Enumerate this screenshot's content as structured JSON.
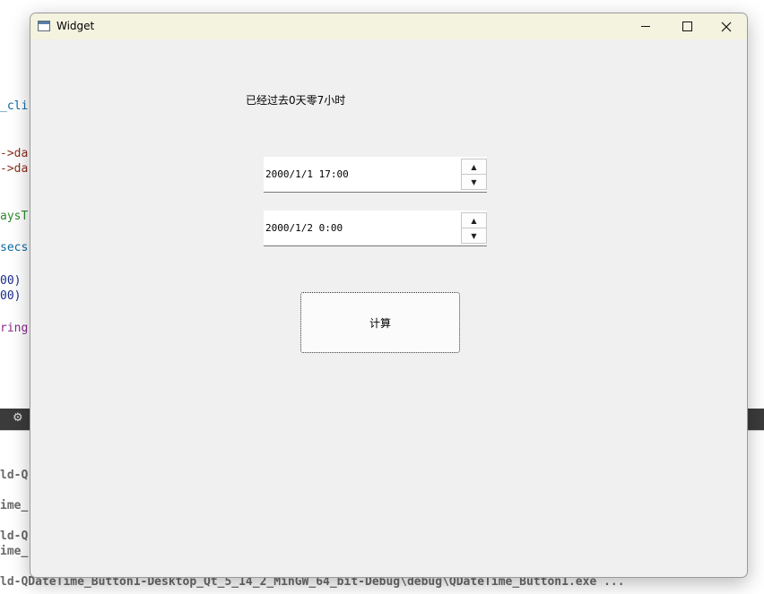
{
  "background": {
    "code_fragments": [
      "_cli",
      "->da",
      "->da",
      "aysT",
      "secs",
      "00)",
      "00)",
      "ring"
    ],
    "output_lines": [
      "ld-Q",
      "ime_",
      "ld-Q",
      "ime_",
      "ld-QDateTime_Button1-Desktop_Qt_5_14_2_MinGW_64_bit-Debug\\debug\\QDateTime_Button1.exe ..."
    ],
    "tool_icons": [
      "⚙"
    ]
  },
  "window": {
    "title": "Widget",
    "elapsed_label": "已经过去0天零7小时",
    "datetime_edit_1": "2000/1/1 17:00",
    "datetime_edit_2": "2000/1/2 0:00",
    "calc_button": "计算",
    "spin_up": "▲",
    "spin_down": "▼"
  },
  "colors": {
    "titlebar": "#f4f3e0",
    "window_bg": "#f0f0f0",
    "code_brown": "#8b2d1c",
    "code_blue": "#0e6aa0",
    "code_green": "#2d8a2d",
    "code_purple": "#8a2b8a",
    "code_navy": "#1a2a8a"
  }
}
